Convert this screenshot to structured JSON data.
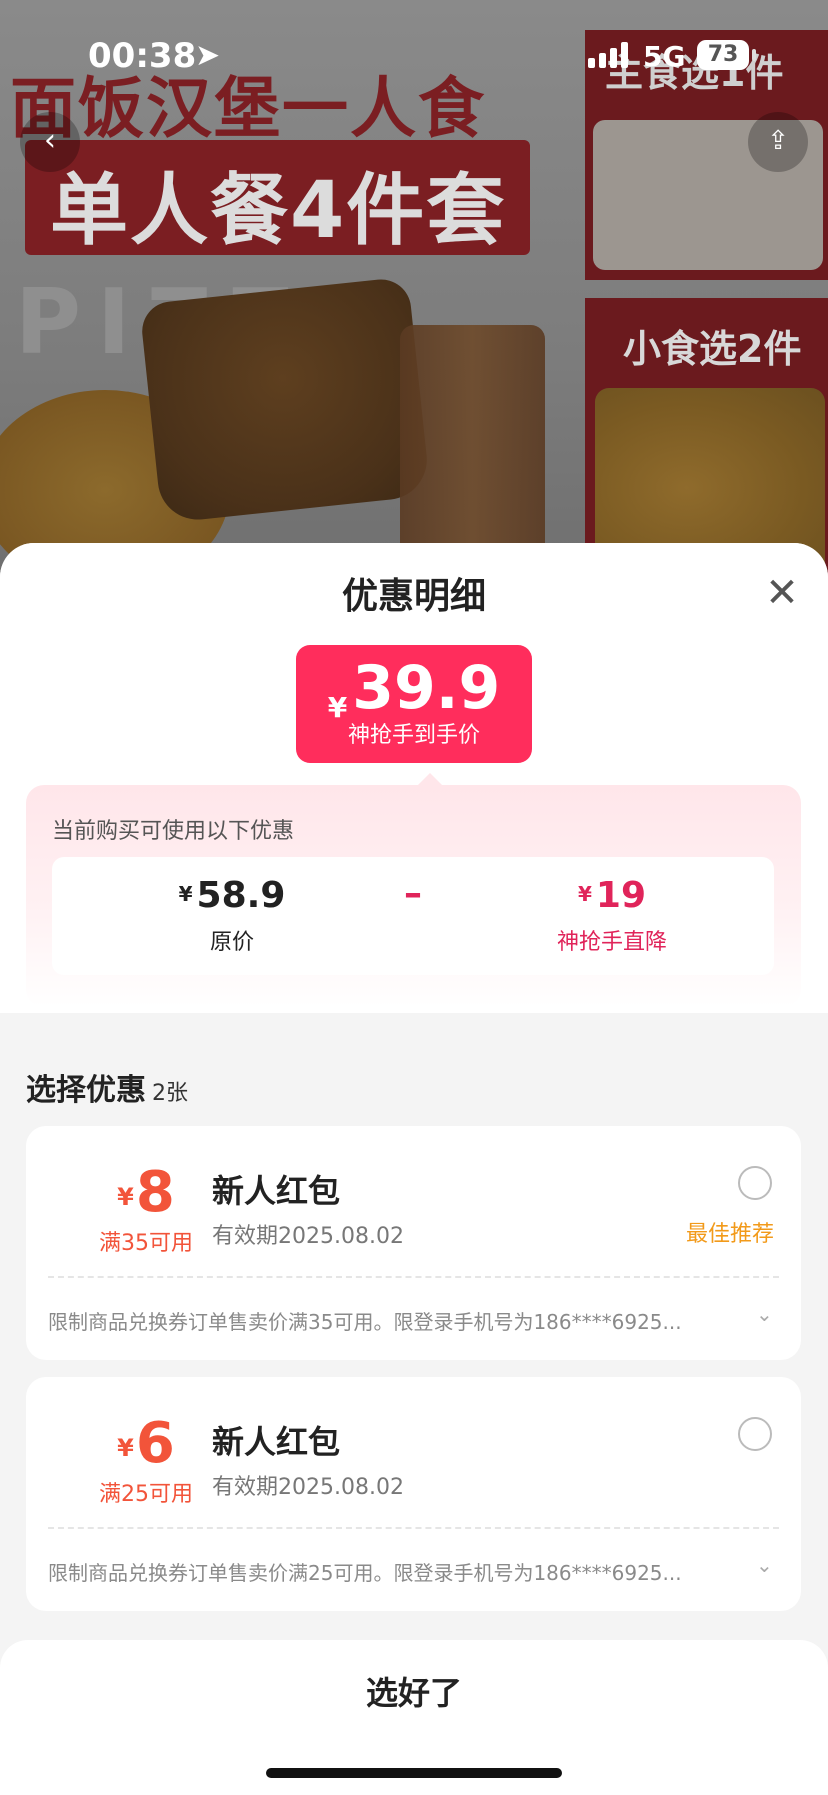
{
  "status_bar": {
    "time": "00:38",
    "network": "5G",
    "battery": "73"
  },
  "banner": {
    "line1": "面饭汉堡一人食",
    "line2": "单人餐4件套",
    "panel_top": "主食选1件",
    "panel_bottom": "小食选2件"
  },
  "sheet": {
    "title": "优惠明细",
    "final_price": {
      "currency": "¥",
      "value": "39.9",
      "label": "神抢手到手价"
    },
    "summary": {
      "hint": "当前购买可使用以下优惠",
      "original": {
        "currency": "¥",
        "value": "58.9",
        "label": "原价"
      },
      "operator": "–",
      "discount": {
        "currency": "¥",
        "value": "19",
        "label": "神抢手直降"
      }
    },
    "section": {
      "title": "选择优惠",
      "count": "2张"
    },
    "coupons": [
      {
        "currency": "¥",
        "value": "8",
        "threshold": "满35可用",
        "name": "新人红包",
        "expiry": "有效期2025.08.02",
        "tag": "最佳推荐",
        "condition": "限制商品兑换券订单售卖价满35可用。限登录手机号为186****6925..."
      },
      {
        "currency": "¥",
        "value": "6",
        "threshold": "满25可用",
        "name": "新人红包",
        "expiry": "有效期2025.08.02",
        "tag": "",
        "condition": "限制商品兑换券订单售卖价满25可用。限登录手机号为186****6925..."
      }
    ],
    "confirm": "选好了"
  },
  "colors": {
    "accent": "#ff2d5c",
    "coupon_red": "#f2543a",
    "best_tag": "#f29a1a"
  }
}
